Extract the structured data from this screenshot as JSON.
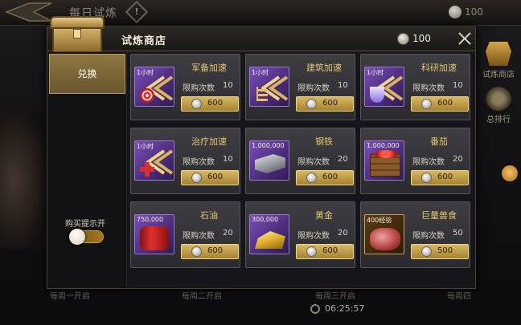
{
  "background": {
    "title": "每日试炼",
    "help_symbol": "!",
    "coin_count": "100",
    "right_menu": [
      {
        "label": "试炼商店",
        "icon": "shop-emblem-icon"
      },
      {
        "label": "总排行",
        "icon": "laurel-ranking-icon"
      }
    ],
    "bottom_labels": [
      "每周一开启",
      "每周二开启",
      "每周三开启",
      "每周四"
    ],
    "timer": "06:25:57"
  },
  "dialog": {
    "title": "试炼商店",
    "coin_count": "100",
    "close_icon": "close-icon",
    "tab_label": "兑换",
    "reminder_label": "购买提示开",
    "reminder_on": true
  },
  "items": [
    {
      "name": "军备加速",
      "qty": "1小时",
      "limit_label": "限购次数",
      "limit": "10",
      "price": "600",
      "art": "target",
      "frame": "purple"
    },
    {
      "name": "建筑加速",
      "qty": "1小时",
      "limit_label": "限购次数",
      "limit": "10",
      "price": "600",
      "art": "build",
      "frame": "purple"
    },
    {
      "name": "科研加速",
      "qty": "1小时",
      "limit_label": "限购次数",
      "limit": "10",
      "price": "600",
      "art": "flask",
      "frame": "purple"
    },
    {
      "name": "治疗加速",
      "qty": "1小时",
      "limit_label": "限购次数",
      "limit": "10",
      "price": "600",
      "art": "cross",
      "frame": "purple"
    },
    {
      "name": "钢铁",
      "qty": "1,000,000",
      "limit_label": "限购次数",
      "limit": "20",
      "price": "600",
      "art": "steel",
      "frame": "purple"
    },
    {
      "name": "番茄",
      "qty": "1,000,000",
      "limit_label": "限购次数",
      "limit": "20",
      "price": "600",
      "art": "crate",
      "frame": "purple"
    },
    {
      "name": "石油",
      "qty": "750,000",
      "limit_label": "限购次数",
      "limit": "20",
      "price": "600",
      "art": "barrel",
      "frame": "purple"
    },
    {
      "name": "黄金",
      "qty": "300,000",
      "limit_label": "限购次数",
      "limit": "20",
      "price": "600",
      "art": "gold",
      "frame": "purple"
    },
    {
      "name": "巨量兽食",
      "qty": "400经验",
      "limit_label": "限购次数",
      "limit": "50",
      "price": "500",
      "art": "meat",
      "frame": "gold"
    }
  ]
}
